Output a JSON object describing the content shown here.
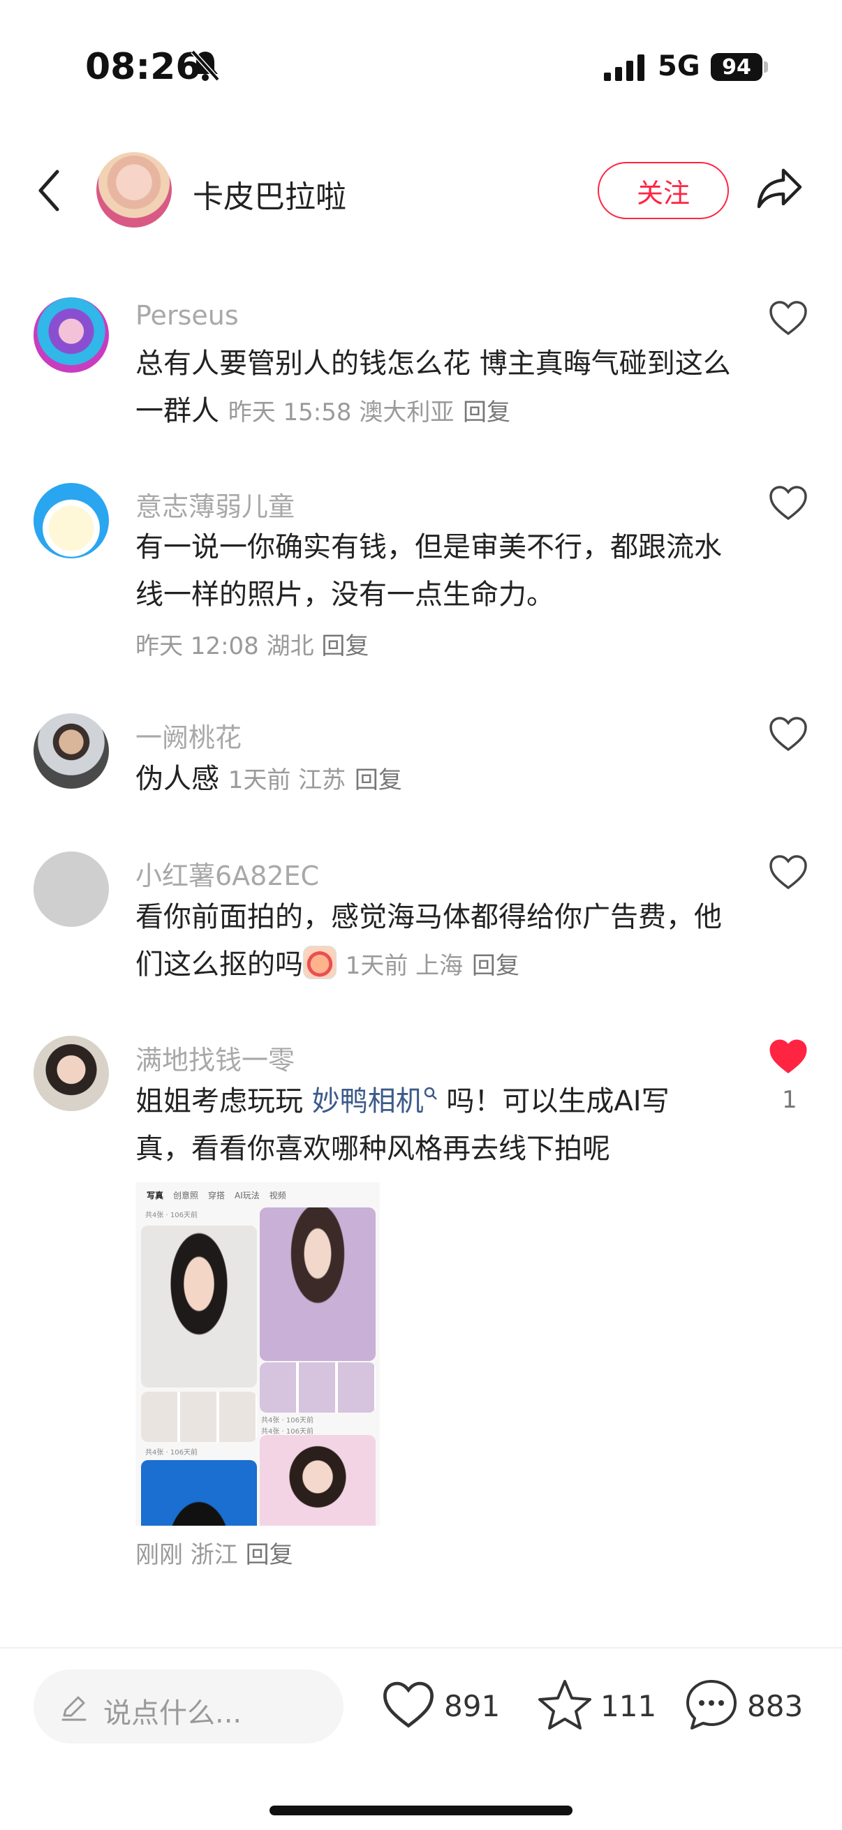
{
  "status_bar": {
    "time": "08:26",
    "network": "5G",
    "battery": "94"
  },
  "header": {
    "author": "卡皮巴拉啦",
    "follow_label": "关注"
  },
  "comments": [
    {
      "name": "Perseus",
      "text": "总有人要管别人的钱怎么花 博主真晦气碰到这么一群人",
      "meta": "昨天 15:58 澳大利亚",
      "reply": "回复",
      "liked": false
    },
    {
      "name": "意志薄弱儿童",
      "text": "有一说一你确实有钱，但是审美不行，都跟流水线一样的照片，没有一点生命力。",
      "meta": "昨天 12:08 湖北",
      "reply": "回复",
      "liked": false
    },
    {
      "name": "一阙桃花",
      "text": "伪人感",
      "meta": "1天前 江苏",
      "reply": "回复",
      "liked": false
    },
    {
      "name": "小红薯6A82EC",
      "text": "看你前面拍的，感觉海马体都得给你广告费，他们这么抠的吗",
      "meta": "1天前 上海",
      "reply": "回复",
      "liked": false
    },
    {
      "name": "满地找钱一零",
      "text_before": "姐姐考虑玩玩 ",
      "link": "妙鸭相机",
      "text_after": " 吗！可以生成AI写真，看看你喜欢哪种风格再去线下拍呢",
      "meta": "刚刚 浙江",
      "reply": "回复",
      "liked": true,
      "like_count": "1"
    }
  ],
  "attachment": {
    "tabs": [
      "写真",
      "创意照",
      "穿搭",
      "AI玩法",
      "视频"
    ],
    "caption_1": "共4张 · 106天前",
    "caption_2": "共4张 · 106天前",
    "caption_3": "共4张 · 106天前",
    "caption_4": "共4张 · 106天前"
  },
  "bottom_bar": {
    "placeholder": "说点什么...",
    "likes": "891",
    "stars": "111",
    "comments": "883"
  },
  "colors": {
    "accent": "#ff2442",
    "link": "#3c5a8a"
  },
  "icons": [
    "bell-slash-icon",
    "signal-icon",
    "back-chevron-icon",
    "share-icon",
    "heart-icon",
    "pencil-icon",
    "star-icon",
    "comment-bubble-icon",
    "search-icon"
  ]
}
